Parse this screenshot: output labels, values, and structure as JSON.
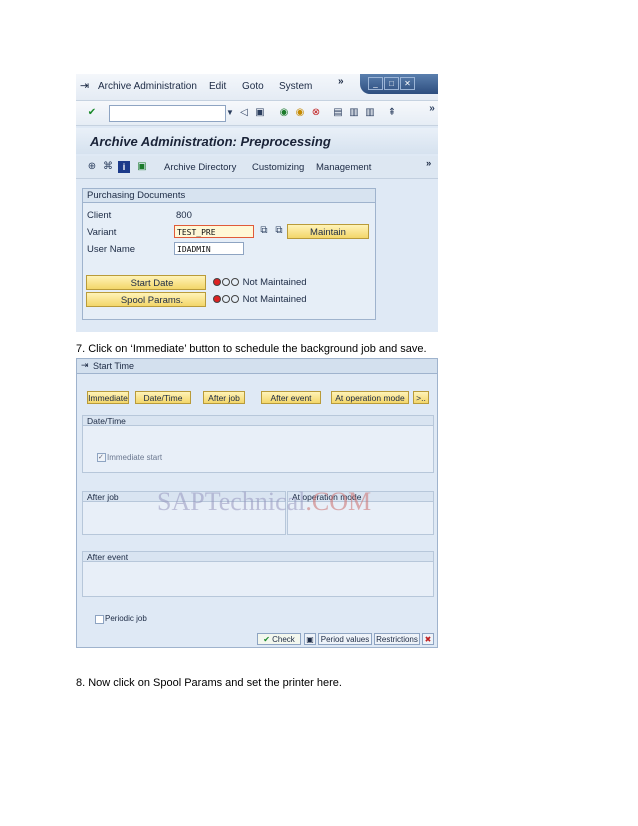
{
  "screen1": {
    "menu": {
      "archive_admin": "Archive Administration",
      "edit": "Edit",
      "goto": "Goto",
      "system": "System",
      "more": "»"
    },
    "title": "Archive Administration: Preprocessing",
    "app_toolbar": {
      "archive_directory": "Archive Directory",
      "customizing": "Customizing",
      "management": "Management",
      "more": "»"
    },
    "group": {
      "title": "Purchasing Documents",
      "client_label": "Client",
      "client_value": "800",
      "variant_label": "Variant",
      "variant_value": "TEST_PRE",
      "maintain_label": "Maintain",
      "user_label": "User Name",
      "user_value": "IDADMIN",
      "start_date_label": "Start Date",
      "start_date_status": "Not Maintained",
      "spool_label": "Spool Params.",
      "spool_status": "Not Maintained"
    }
  },
  "step7": "7.    Click on ‘Immediate’ button to schedule the background job and save.",
  "screen2": {
    "window_title": "Start Time",
    "buttons": {
      "immediate": "Immediate",
      "date_time": "Date/Time",
      "after_job": "After job",
      "after_event": "After event",
      "at_operation_mode": "At operation mode",
      "more": ">.."
    },
    "date_time_header": "Date/Time",
    "immediate_start": "Immediate start",
    "after_job_header": "After job",
    "at_operation_mode_header": "At operation mode",
    "after_event_header": "After event",
    "periodic_job": "Periodic job",
    "watermark_a": "SAPTechnical",
    "watermark_b": ".COM",
    "footer": {
      "check": "Check",
      "period_values": "Period values",
      "restrictions": "Restrictions"
    }
  },
  "step8": "8.    Now click on Spool Params and set the printer here."
}
